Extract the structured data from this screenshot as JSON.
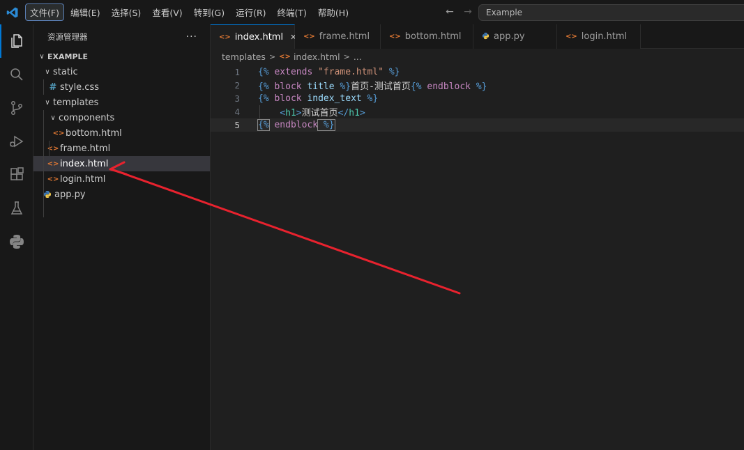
{
  "menu": {
    "items": [
      "文件(F)",
      "编辑(E)",
      "选择(S)",
      "查看(V)",
      "转到(G)",
      "运行(R)",
      "终端(T)",
      "帮助(H)"
    ]
  },
  "command_center": {
    "text": "Example"
  },
  "sidebar": {
    "title": "资源管理器",
    "more": "···",
    "root": "EXAMPLE",
    "tree": [
      {
        "label": "static",
        "type": "folder",
        "depth": 1
      },
      {
        "label": "style.css",
        "type": "css",
        "depth": 2
      },
      {
        "label": "templates",
        "type": "folder",
        "depth": 1
      },
      {
        "label": "components",
        "type": "folder",
        "depth": 2
      },
      {
        "label": "bottom.html",
        "type": "html",
        "depth": 3
      },
      {
        "label": "frame.html",
        "type": "html",
        "depth": 2
      },
      {
        "label": "index.html",
        "type": "html",
        "depth": 2,
        "selected": true
      },
      {
        "label": "login.html",
        "type": "html",
        "depth": 2
      },
      {
        "label": "app.py",
        "type": "py",
        "depth": 1
      }
    ]
  },
  "tabs": [
    {
      "label": "index.html",
      "type": "html",
      "active": true
    },
    {
      "label": "frame.html",
      "type": "html"
    },
    {
      "label": "bottom.html",
      "type": "html"
    },
    {
      "label": "app.py",
      "type": "py"
    },
    {
      "label": "login.html",
      "type": "html"
    }
  ],
  "breadcrumb": [
    "templates",
    "index.html",
    "..."
  ],
  "code": {
    "line_numbers": [
      "1",
      "2",
      "3",
      "4",
      "5"
    ],
    "current_line": 5,
    "lines": [
      [
        [
          "delim",
          "{%"
        ],
        [
          "kw",
          " extends "
        ],
        [
          "str",
          "\"frame.html\""
        ],
        [
          "delim",
          " %}"
        ]
      ],
      [
        [
          "delim",
          "{%"
        ],
        [
          "kw",
          " block "
        ],
        [
          "id",
          "title"
        ],
        [
          "delim",
          " %}"
        ],
        [
          "text",
          "首页-测试首页"
        ],
        [
          "delim",
          "{%"
        ],
        [
          "kw",
          " endblock"
        ],
        [
          "delim",
          " %}"
        ]
      ],
      [
        [
          "delim",
          "{%"
        ],
        [
          "kw",
          " block "
        ],
        [
          "id",
          "index_text"
        ],
        [
          "delim",
          " %}"
        ]
      ],
      [
        [
          "text",
          "    "
        ],
        [
          "tag",
          "<"
        ],
        [
          "tagname",
          "h1"
        ],
        [
          "tag",
          ">"
        ],
        [
          "text",
          "测试首页"
        ],
        [
          "tag",
          "</"
        ],
        [
          "tagname",
          "h1"
        ],
        [
          "tag",
          ">"
        ]
      ],
      [
        [
          "delim",
          "{%"
        ],
        [
          "kw",
          " endblock"
        ],
        [
          "delim",
          " %}"
        ]
      ]
    ]
  },
  "colors": {
    "accent": "#0078d4",
    "annotation_arrow": "#e8222e",
    "html_icon": "#e37933",
    "css_icon": "#519aba",
    "py_icon": "#3e7ab7"
  },
  "icons": {
    "activity_bar": [
      "explorer-icon",
      "search-icon",
      "source-control-icon",
      "run-debug-icon",
      "extensions-icon",
      "testing-icon",
      "python-icon"
    ]
  }
}
